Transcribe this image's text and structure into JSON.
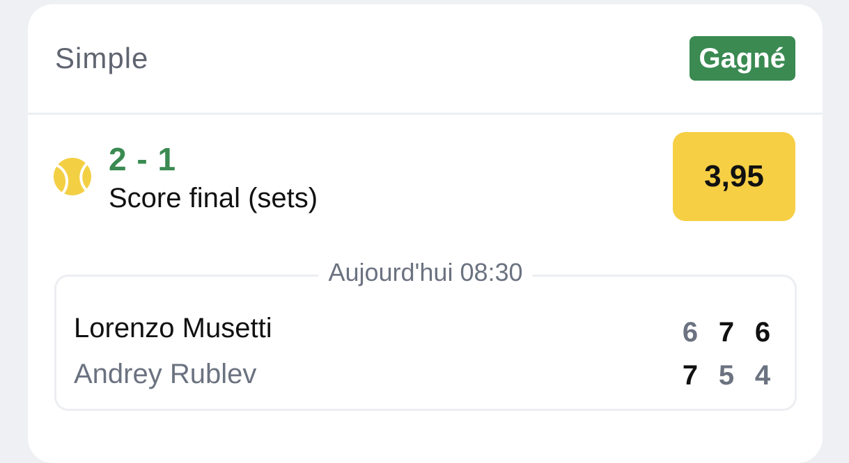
{
  "bet": {
    "type": "Simple",
    "status": "Gagné",
    "status_color": "#3a8a52"
  },
  "selection": {
    "sport_icon": "tennis-ball-icon",
    "score": "2 - 1",
    "market": "Score final (sets)",
    "odds": "3,95"
  },
  "match": {
    "datetime": "Aujourd'hui 08:30",
    "players": [
      {
        "name": "Lorenzo Musetti",
        "sets": [
          "6",
          "7",
          "6"
        ],
        "set_won": [
          false,
          true,
          true
        ]
      },
      {
        "name": "Andrey Rublev",
        "sets": [
          "7",
          "5",
          "4"
        ],
        "set_won": [
          true,
          false,
          false
        ]
      }
    ]
  },
  "colors": {
    "win_green": "#3a8a52",
    "odds_yellow": "#f6cf45",
    "muted_gray": "#6b7280"
  }
}
